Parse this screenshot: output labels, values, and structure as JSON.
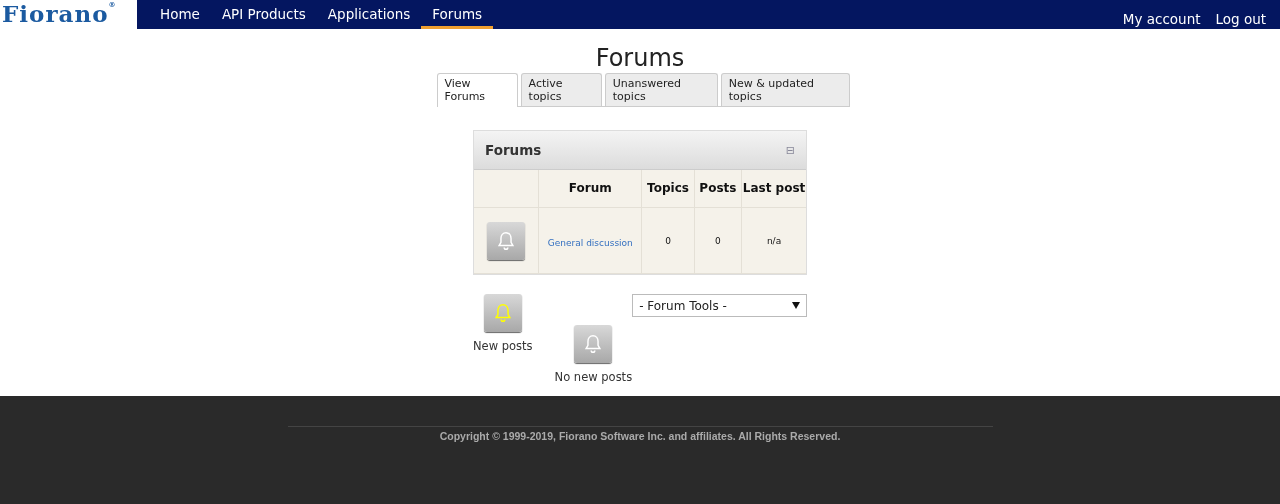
{
  "logo": {
    "text": "Fiorano",
    "mark": "®"
  },
  "nav": [
    {
      "label": "Home",
      "selected": false
    },
    {
      "label": "API Products",
      "selected": false
    },
    {
      "label": "Applications",
      "selected": false
    },
    {
      "label": "Forums",
      "selected": true
    }
  ],
  "account_links": [
    "My account",
    "Log out"
  ],
  "title": "Forums",
  "tabs": [
    {
      "label": "View Forums",
      "selected": true
    },
    {
      "label": "Active topics",
      "selected": false
    },
    {
      "label": "Unanswered topics",
      "selected": false
    },
    {
      "label": "New & updated topics",
      "selected": false
    }
  ],
  "panel": {
    "title": "Forums",
    "collapse_icon": "⊟",
    "columns": [
      "Forum",
      "Topics",
      "Posts",
      "Last post"
    ],
    "rows": [
      {
        "new": false,
        "forum": "General discussion",
        "topics": "0",
        "posts": "0",
        "last_post": "n/a"
      }
    ]
  },
  "legend": [
    {
      "new": true,
      "label": "New posts"
    },
    {
      "new": false,
      "label": "No new posts"
    }
  ],
  "forum_tools": {
    "value": "- Forum Tools -"
  },
  "footer": "Copyright © 1999-2019, Fiorano Software Inc. and affiliates. All Rights Reserved."
}
